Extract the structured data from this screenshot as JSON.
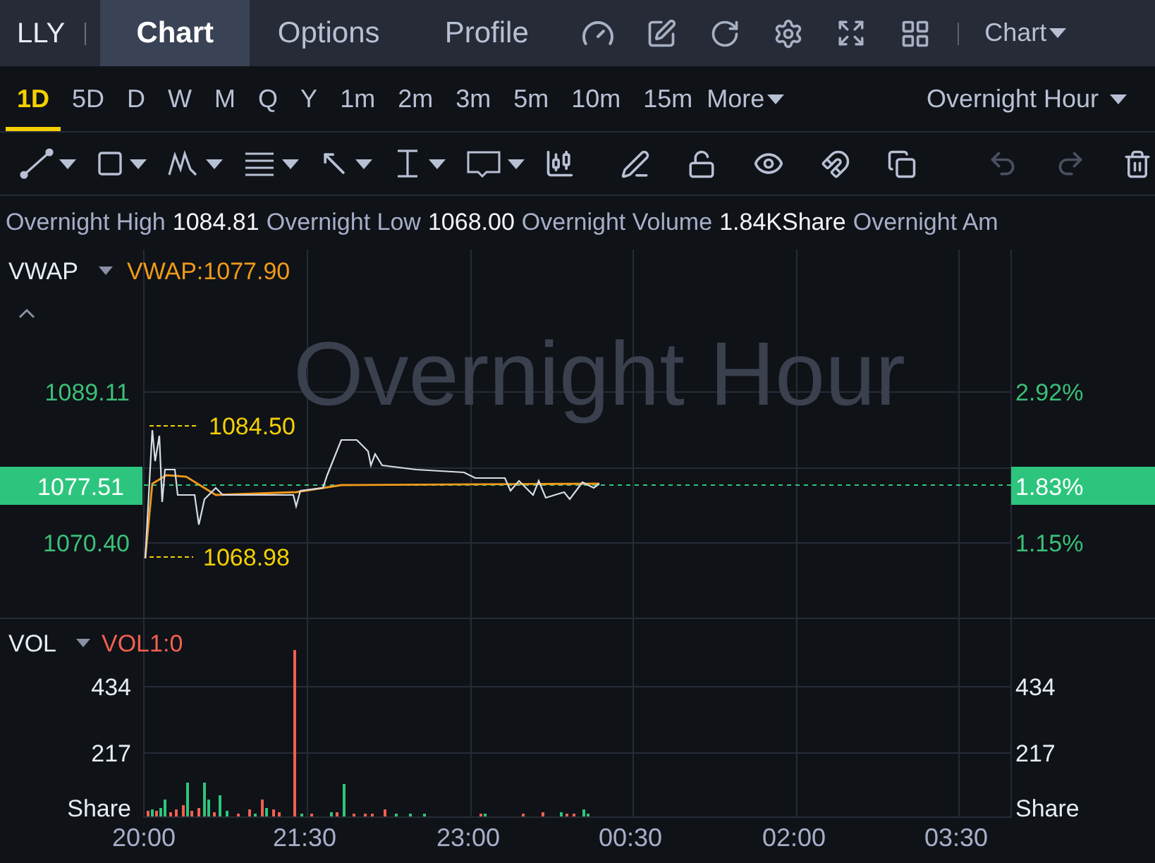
{
  "symbol": "LLY",
  "tabs": [
    {
      "label": "Chart",
      "selected": true
    },
    {
      "label": "Options",
      "selected": false
    },
    {
      "label": "Profile",
      "selected": false
    }
  ],
  "view_menu": {
    "label": "Chart"
  },
  "periods": [
    {
      "label": "1D",
      "selected": true
    },
    {
      "label": "5D",
      "selected": false
    },
    {
      "label": "D",
      "selected": false
    },
    {
      "label": "W",
      "selected": false
    },
    {
      "label": "M",
      "selected": false
    },
    {
      "label": "Q",
      "selected": false
    },
    {
      "label": "Y",
      "selected": false
    },
    {
      "label": "1m",
      "selected": false
    },
    {
      "label": "2m",
      "selected": false
    },
    {
      "label": "3m",
      "selected": false
    },
    {
      "label": "5m",
      "selected": false
    },
    {
      "label": "10m",
      "selected": false
    },
    {
      "label": "15m",
      "selected": false
    }
  ],
  "more_menu": {
    "label": "More"
  },
  "session_menu": {
    "label": "Overnight Hour"
  },
  "history_buttons": [
    {
      "disabled": true
    },
    {
      "disabled": true
    }
  ],
  "stats": [
    {
      "label": "Overnight High",
      "value": "1084.81"
    },
    {
      "label": "Overnight Low",
      "value": "1068.00"
    },
    {
      "label": "Overnight Volume",
      "value": "1.84KShare"
    },
    {
      "label": "Overnight Am"
    }
  ],
  "price_chart": {
    "indicator": "VWAP",
    "indicator_value": "VWAP:1077.90",
    "watermark": "Overnight Hour",
    "left_ticks": [
      "1089.11",
      "1070.40"
    ],
    "right_ticks": [
      "2.92%",
      "1.15%"
    ],
    "last_price": "1077.51",
    "last_change": "1.83%",
    "high_label": "1084.50",
    "low_label": "1068.98"
  },
  "volume_chart": {
    "indicator": "VOL",
    "indicator_value": "VOL1:0",
    "left_ticks": [
      "434",
      "217",
      "Share"
    ],
    "right_ticks": [
      "434",
      "217",
      "Share"
    ]
  },
  "time_axis": [
    "20:00",
    "21:30",
    "23:00",
    "00:30",
    "02:00",
    "03:30"
  ]
}
